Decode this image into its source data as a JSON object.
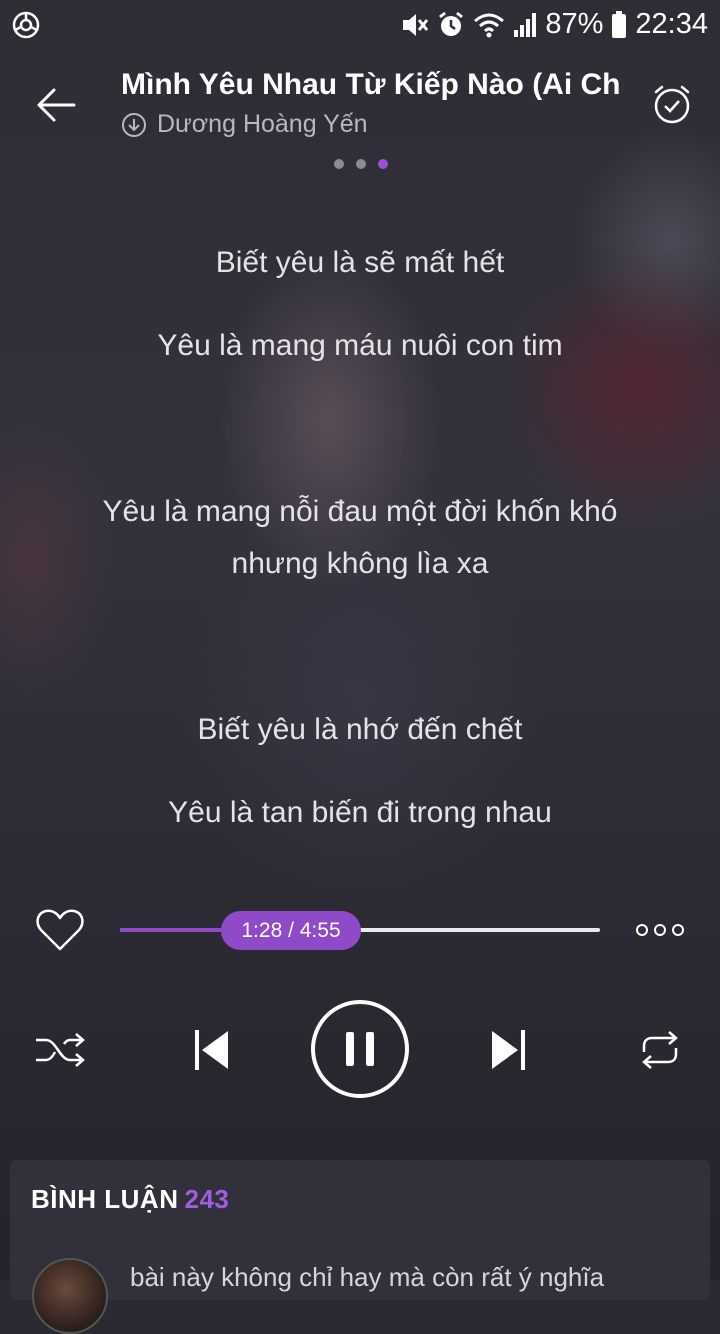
{
  "status_bar": {
    "battery": "87%",
    "time": "22:34",
    "icons": [
      "app-icon",
      "mute-icon",
      "alarm-icon",
      "wifi-icon",
      "signal-icon",
      "battery-icon"
    ]
  },
  "header": {
    "title": "Mình Yêu Nhau Từ Kiếp Nào (Ai Ch...",
    "artist": "Dương Hoàng Yến",
    "page_count": 3,
    "active_page": 3
  },
  "lyrics": [
    "Biết yêu là sẽ mất hết",
    "Yêu là mang máu nuôi con tim",
    "Yêu là mang nỗi đau một đời khốn khó",
    "nhưng không lìa xa",
    "Biết yêu là nhớ đến chết",
    "Yêu là tan biến đi trong nhau"
  ],
  "player": {
    "current_time": "1:28",
    "duration": "4:55",
    "time_label": "1:28 / 4:55",
    "progress_fraction": 0.298
  },
  "colors": {
    "accent": "#8f4ac9",
    "accent_text": "#a25ce0",
    "active_dot": "#9b4fd8"
  },
  "comments": {
    "title": "BÌNH LUẬN",
    "count": "243",
    "first_comment": "bài này không chỉ hay mà còn rất ý nghĩa"
  }
}
